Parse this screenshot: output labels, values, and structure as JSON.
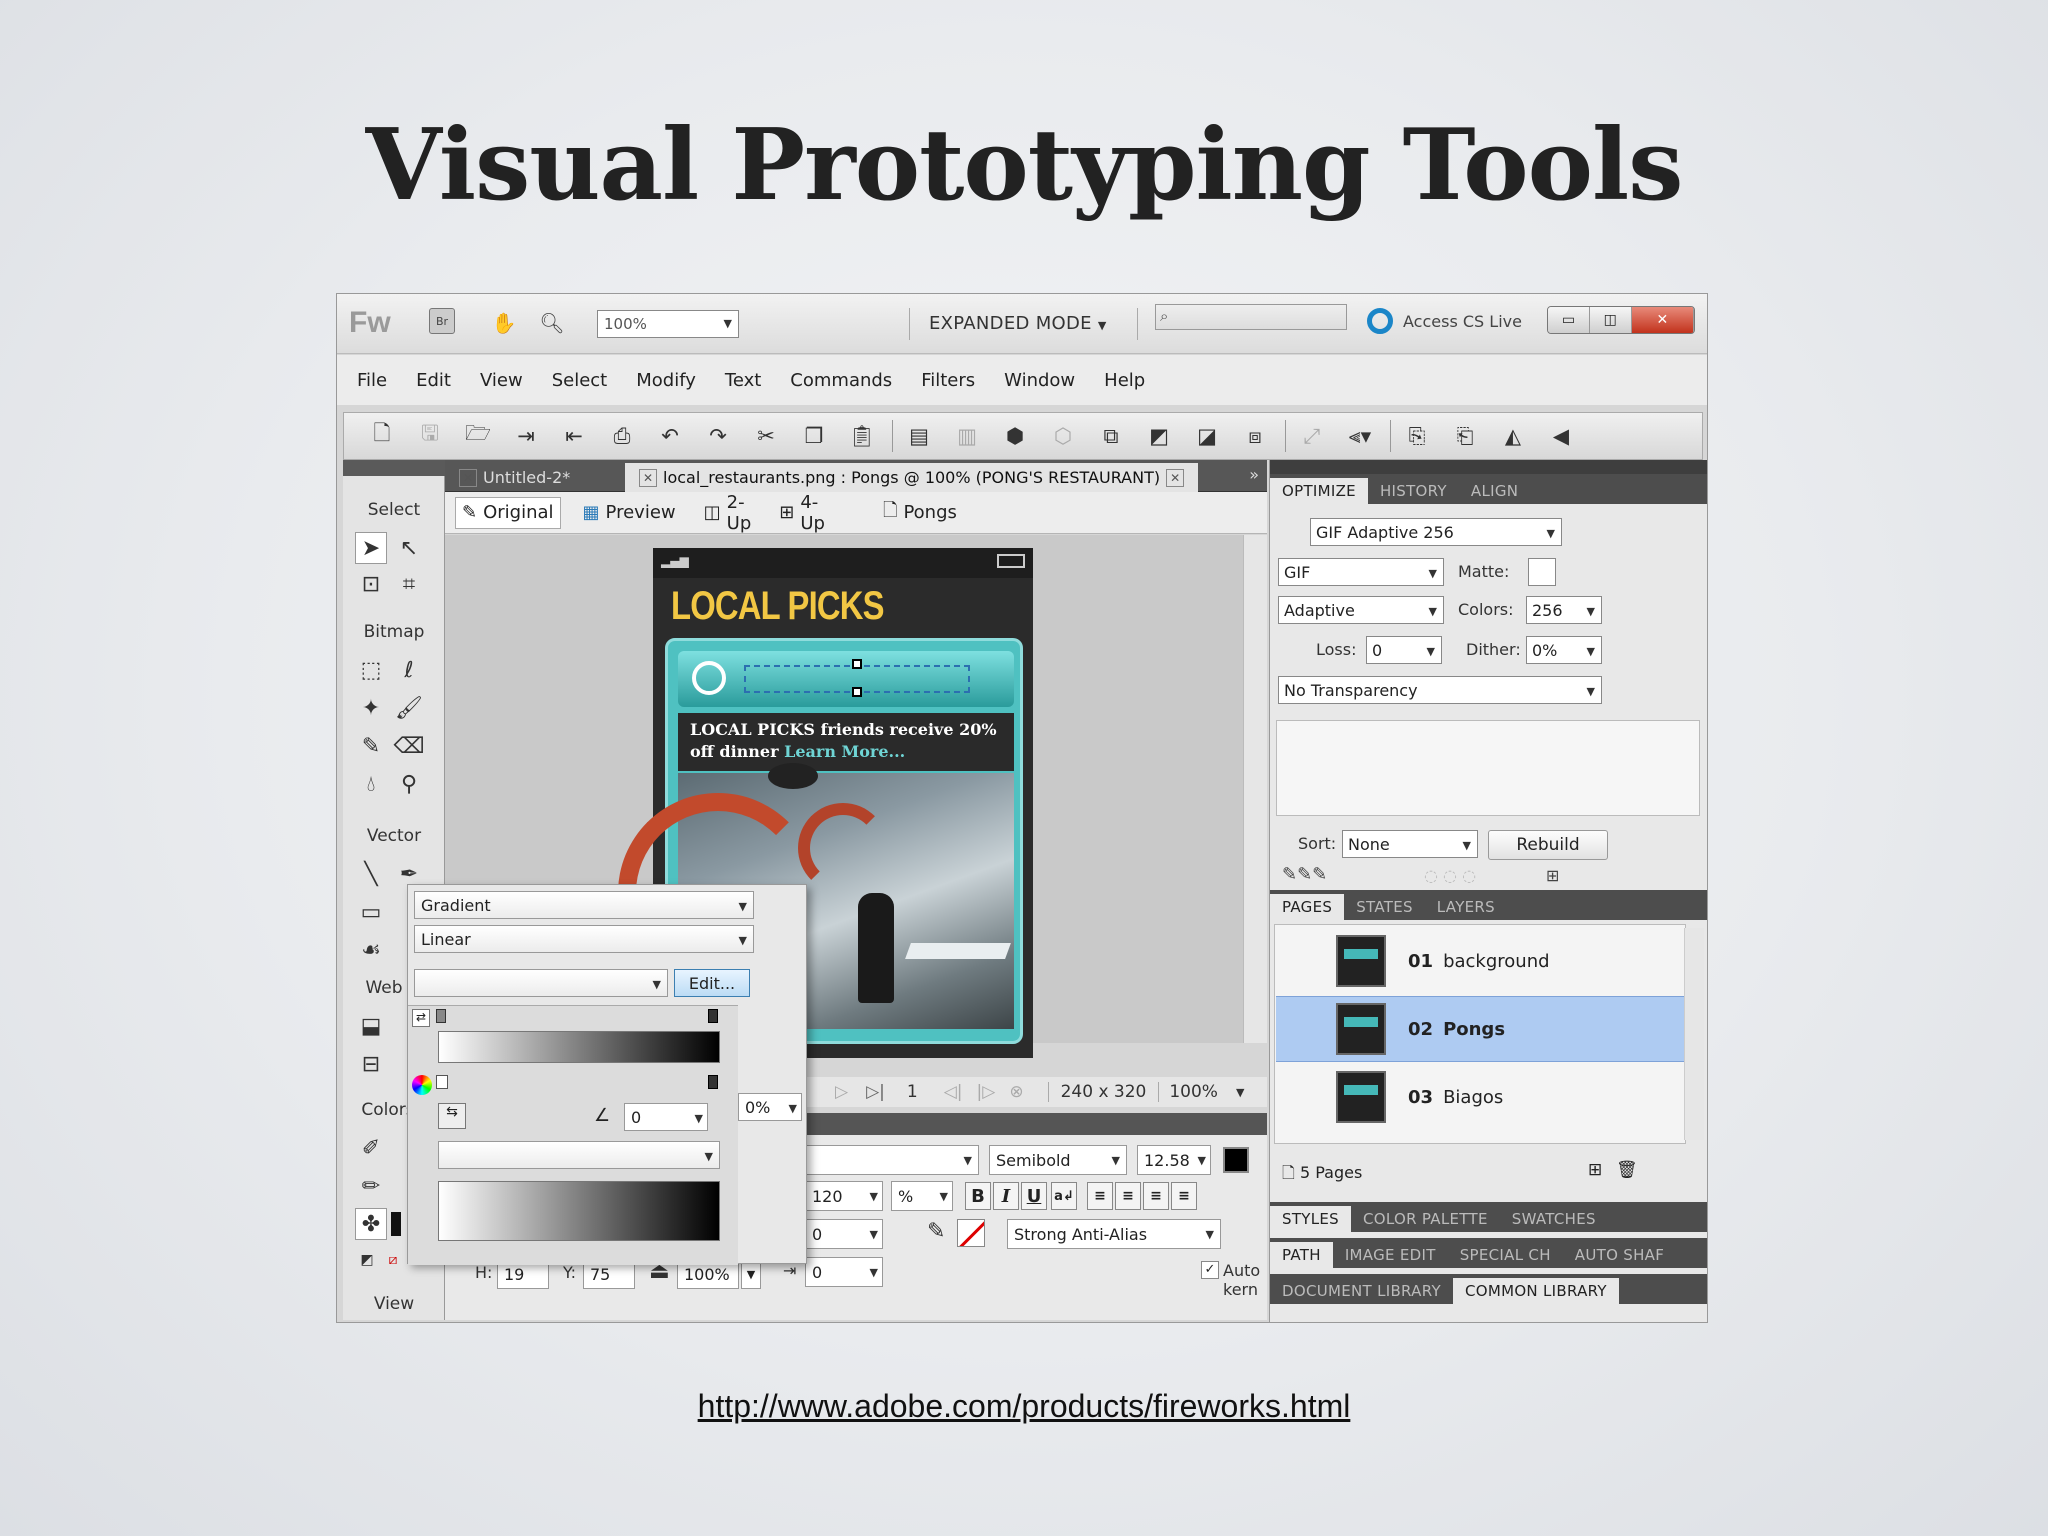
{
  "slide": {
    "title": "Visual Prototyping Tools",
    "link": "http://www.adobe.com/products/fireworks.html"
  },
  "app": {
    "logo": "Fw",
    "zoom": "100%",
    "mode": "EXPANDED MODE",
    "cs_live": "Access CS Live",
    "accent_color": "#1b86c8"
  },
  "menu": [
    "File",
    "Edit",
    "View",
    "Select",
    "Modify",
    "Text",
    "Commands",
    "Filters",
    "Window",
    "Help"
  ],
  "toolbar_icons": [
    "new-icon",
    "save-icon",
    "open-icon",
    "import-icon",
    "export-icon",
    "print-icon",
    "undo-icon",
    "redo-icon",
    "cut-icon",
    "copy-icon",
    "paste-icon",
    "group-icon",
    "ungroup-icon",
    "join-icon",
    "split-icon",
    "bring-front-icon",
    "bring-forward-icon",
    "send-backward-icon",
    "send-back-icon",
    "smart-shape-icon",
    "align-icon",
    "rotate-icon",
    "flip-icon",
    "flip-h-icon",
    "flip-v-icon"
  ],
  "tools": {
    "sections": [
      "Select",
      "Bitmap",
      "Vector",
      "Web",
      "Colors",
      "View"
    ]
  },
  "doc": {
    "tab1": "Untitled-2*",
    "tab2": "local_restaurants.png : Pongs @ 100% (PONG'S RESTAURANT)",
    "views": [
      "Original",
      "Preview",
      "2-Up",
      "4-Up"
    ],
    "page": "Pongs"
  },
  "phone": {
    "brand": "LOCAL PICKS",
    "promo": "LOCAL PICKS friends receive 20% off dinner",
    "promo_link": "Learn More..."
  },
  "status": {
    "frame": "1",
    "size": "240 x 320",
    "zoom": "100%"
  },
  "properties": {
    "font_style": "Semibold",
    "font_size": "12.58",
    "leading": "120",
    "leading_unit": "%",
    "indent1": "0",
    "indent2": "0",
    "antialias": "Strong Anti-Alias",
    "autokern": "Auto kern",
    "h_label": "H:",
    "h": "19",
    "y_label": "Y:",
    "y": "75",
    "scale": "100%",
    "opacity_fragment": "0%"
  },
  "fill_popup": {
    "fill_type": "Gradient",
    "gradient_type": "Linear",
    "edit_label": "Edit...",
    "angle": "0"
  },
  "optimize": {
    "tabs": [
      "OPTIMIZE",
      "HISTORY",
      "ALIGN"
    ],
    "preset": "GIF Adaptive 256",
    "format": "GIF",
    "matte_label": "Matte:",
    "palette": "Adaptive",
    "colors_label": "Colors:",
    "colors": "256",
    "loss_label": "Loss:",
    "loss": "0",
    "dither_label": "Dither:",
    "dither": "0%",
    "transparency": "No Transparency",
    "sort_label": "Sort:",
    "sort": "None",
    "rebuild": "Rebuild"
  },
  "pages": {
    "tabs": [
      "PAGES",
      "STATES",
      "LAYERS"
    ],
    "items": [
      {
        "num": "01",
        "name": "background"
      },
      {
        "num": "02",
        "name": "Pongs"
      },
      {
        "num": "03",
        "name": "Biagos"
      }
    ],
    "count": "5 Pages"
  },
  "panels": {
    "styles": [
      "STYLES",
      "COLOR PALETTE",
      "SWATCHES"
    ],
    "path": [
      "PATH",
      "IMAGE EDIT",
      "SPECIAL CH",
      "AUTO SHAF"
    ],
    "library": [
      "DOCUMENT LIBRARY",
      "COMMON LIBRARY"
    ]
  }
}
